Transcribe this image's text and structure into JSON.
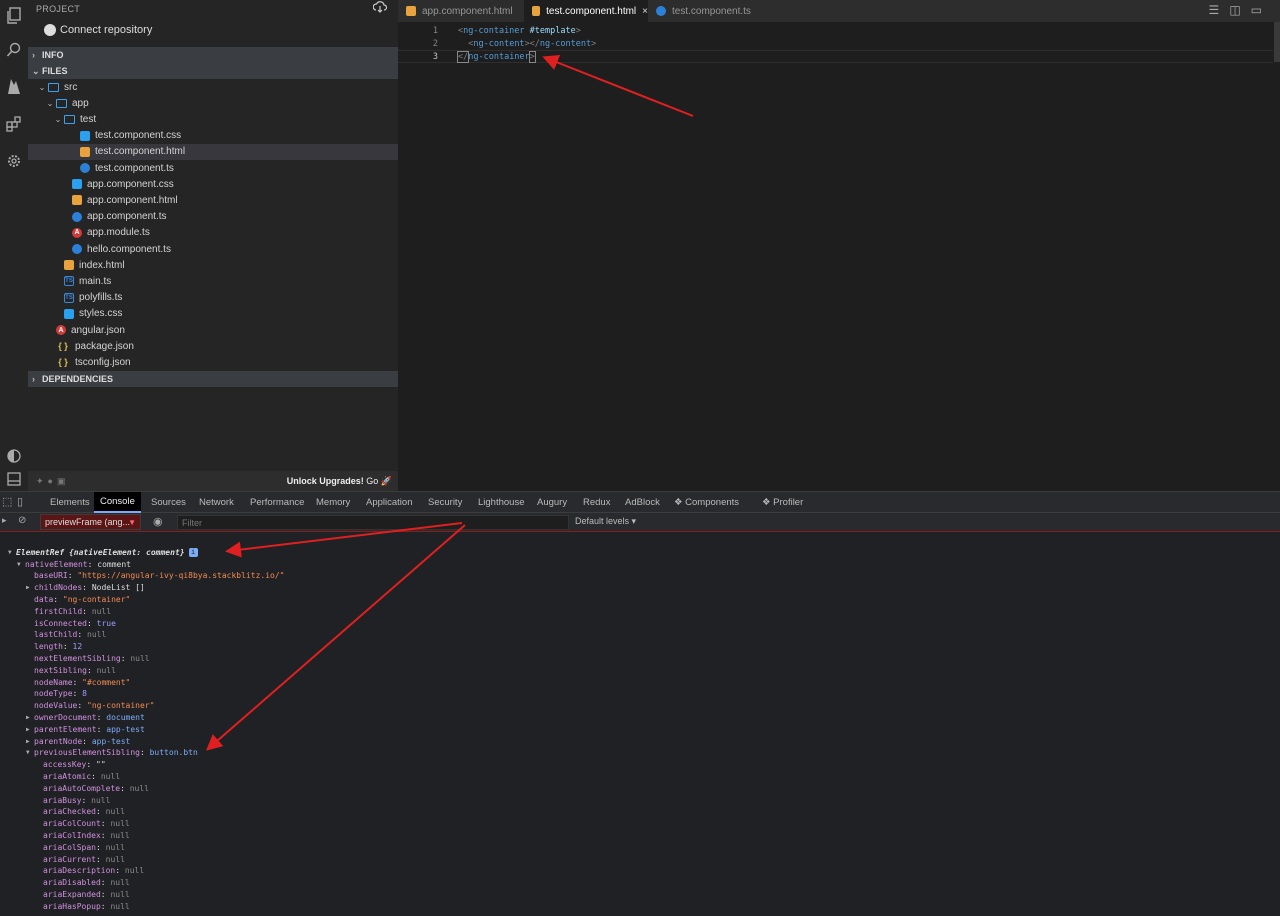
{
  "sidebar": {
    "title": "PROJECT",
    "connect_label": "Connect repository",
    "sections": {
      "info": "INFO",
      "files": "FILES",
      "dependencies": "DEPENDENCIES"
    },
    "tree": [
      {
        "label": "src",
        "icon": "folder-icon"
      },
      {
        "label": "app",
        "icon": "folder-icon"
      },
      {
        "label": "test",
        "icon": "folder-icon"
      },
      {
        "label": "test.component.css",
        "icon": "css-file-icon"
      },
      {
        "label": "test.component.html",
        "icon": "html-file-icon"
      },
      {
        "label": "test.component.ts",
        "icon": "angular-ts-icon"
      },
      {
        "label": "app.component.css",
        "icon": "css-file-icon"
      },
      {
        "label": "app.component.html",
        "icon": "html-file-icon"
      },
      {
        "label": "app.component.ts",
        "icon": "angular-ts-icon"
      },
      {
        "label": "app.module.ts",
        "icon": "angular-module-icon"
      },
      {
        "label": "hello.component.ts",
        "icon": "angular-ts-icon"
      },
      {
        "label": "index.html",
        "icon": "html-file-icon"
      },
      {
        "label": "main.ts",
        "icon": "ts-file-icon"
      },
      {
        "label": "polyfills.ts",
        "icon": "ts-file-icon"
      },
      {
        "label": "styles.css",
        "icon": "css-file-icon"
      },
      {
        "label": "angular.json",
        "icon": "angular-icon"
      },
      {
        "label": "package.json",
        "icon": "json-icon"
      },
      {
        "label": "tsconfig.json",
        "icon": "json-icon"
      }
    ],
    "footer": {
      "unlock_bold": "Unlock Upgrades!",
      "unlock_rest": " Go 🚀"
    }
  },
  "editor": {
    "tabs": [
      {
        "label": "app.component.html",
        "icon": "html-file-icon"
      },
      {
        "label": "test.component.html",
        "icon": "html-file-icon",
        "active": true
      },
      {
        "label": "test.component.ts",
        "icon": "angular-ts-icon"
      }
    ],
    "close_glyph": "×",
    "lines": [
      {
        "num": "1",
        "open": "<",
        "tag": "ng-container",
        "attr": " #template",
        "close": ">"
      },
      {
        "num": "2",
        "indent": "  ",
        "open": "<",
        "tag": "ng-content",
        "mid": "></",
        "tag2": "ng-content",
        "close": ">"
      },
      {
        "num": "3",
        "open": "</",
        "tag": "ng-container",
        "close": ">"
      }
    ]
  },
  "devtools": {
    "tabs": [
      "Elements",
      "Console",
      "Sources",
      "Network",
      "Performance",
      "Memory",
      "Application",
      "Security",
      "Lighthouse",
      "Augury",
      "Redux",
      "AdBlock",
      "❖ Components",
      "❖ Profiler"
    ],
    "active_tab": "Console",
    "context": "previewFrame (ang...",
    "filter_placeholder": "Filter",
    "levels": "Default levels ▾"
  },
  "console": {
    "header": "ElementRef {nativeElement: comment}",
    "info_badge": "i",
    "lines": [
      {
        "indent": 1,
        "expand": "open",
        "key": "nativeElement",
        "val": "comment",
        "kind": "plain"
      },
      {
        "indent": 2,
        "key": "baseURI",
        "val": "\"https://angular-ivy-qi8bya.stackblitz.io/\"",
        "kind": "str"
      },
      {
        "indent": 2,
        "expand": "closed",
        "key": "childNodes",
        "val": "NodeList []",
        "kind": "plain"
      },
      {
        "indent": 2,
        "key": "data",
        "val": "\"ng-container\"",
        "kind": "str"
      },
      {
        "indent": 2,
        "key": "firstChild",
        "val": "null",
        "kind": "null"
      },
      {
        "indent": 2,
        "key": "isConnected",
        "val": "true",
        "kind": "bool"
      },
      {
        "indent": 2,
        "key": "lastChild",
        "val": "null",
        "kind": "null"
      },
      {
        "indent": 2,
        "key": "length",
        "val": "12",
        "kind": "num"
      },
      {
        "indent": 2,
        "key": "nextElementSibling",
        "val": "null",
        "kind": "null"
      },
      {
        "indent": 2,
        "key": "nextSibling",
        "val": "null",
        "kind": "null"
      },
      {
        "indent": 2,
        "key": "nodeName",
        "val": "\"#comment\"",
        "kind": "str"
      },
      {
        "indent": 2,
        "key": "nodeType",
        "val": "8",
        "kind": "num"
      },
      {
        "indent": 2,
        "key": "nodeValue",
        "val": "\"ng-container\"",
        "kind": "str"
      },
      {
        "indent": 2,
        "expand": "closed",
        "key": "ownerDocument",
        "val": "document",
        "kind": "obj"
      },
      {
        "indent": 2,
        "expand": "closed",
        "key": "parentElement",
        "val": "app-test",
        "kind": "obj"
      },
      {
        "indent": 2,
        "expand": "closed",
        "key": "parentNode",
        "val": "app-test",
        "kind": "obj"
      },
      {
        "indent": 2,
        "expand": "open",
        "key": "previousElementSibling",
        "val": "button.btn",
        "kind": "obj"
      },
      {
        "indent": 3,
        "key": "accessKey",
        "val": "\"\"",
        "kind": "plain"
      },
      {
        "indent": 3,
        "key": "ariaAtomic",
        "val": "null",
        "kind": "null"
      },
      {
        "indent": 3,
        "key": "ariaAutoComplete",
        "val": "null",
        "kind": "null"
      },
      {
        "indent": 3,
        "key": "ariaBusy",
        "val": "null",
        "kind": "null"
      },
      {
        "indent": 3,
        "key": "ariaChecked",
        "val": "null",
        "kind": "null"
      },
      {
        "indent": 3,
        "key": "ariaColCount",
        "val": "null",
        "kind": "null"
      },
      {
        "indent": 3,
        "key": "ariaColIndex",
        "val": "null",
        "kind": "null"
      },
      {
        "indent": 3,
        "key": "ariaColSpan",
        "val": "null",
        "kind": "null"
      },
      {
        "indent": 3,
        "key": "ariaCurrent",
        "val": "null",
        "kind": "null"
      },
      {
        "indent": 3,
        "key": "ariaDescription",
        "val": "null",
        "kind": "null"
      },
      {
        "indent": 3,
        "key": "ariaDisabled",
        "val": "null",
        "kind": "null"
      },
      {
        "indent": 3,
        "key": "ariaExpanded",
        "val": "null",
        "kind": "null"
      },
      {
        "indent": 3,
        "key": "ariaHasPopup",
        "val": "null",
        "kind": "null"
      }
    ]
  },
  "colors": {
    "accent_arrow": "#e02020",
    "tag": "#569cd6",
    "string": "#f28b54"
  }
}
